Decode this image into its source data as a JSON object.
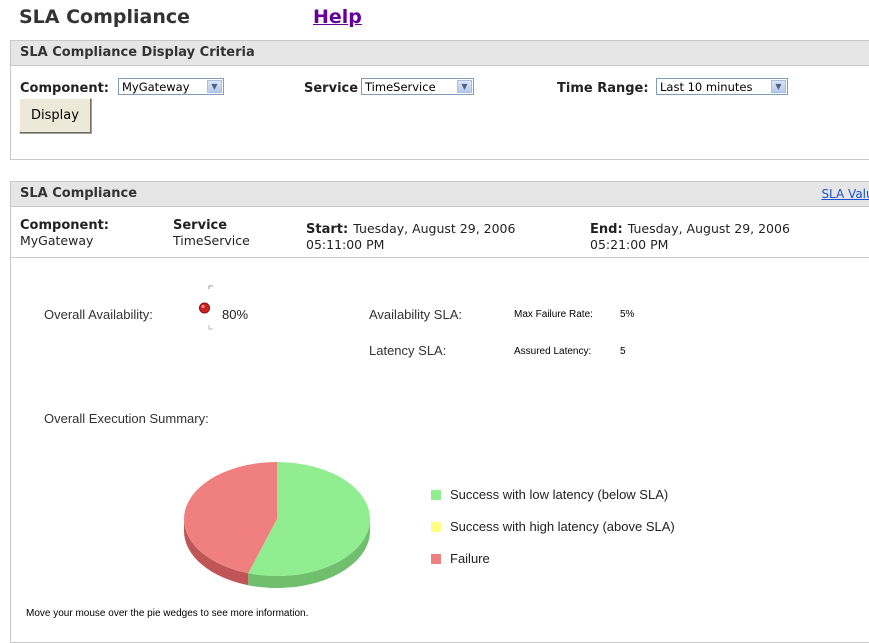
{
  "header": {
    "title": "SLA Compliance",
    "help_label": "Help"
  },
  "criteria": {
    "panel_title": "SLA Compliance Display Criteria",
    "component_label": "Component:",
    "component_value": "MyGateway",
    "service_label": "Service",
    "service_value": "TimeService",
    "time_range_label": "Time Range:",
    "time_range_value": "Last 10 minutes",
    "display_button": "Display"
  },
  "compliance": {
    "panel_title": "SLA Compliance",
    "sla_values_link": "SLA Value",
    "component_label": "Component:",
    "component_value": "MyGateway",
    "service_label": "Service",
    "service_value": "TimeService",
    "start_label": "Start:",
    "start_date": "Tuesday, August 29, 2006",
    "start_time": "05:11:00 PM",
    "end_label": "End:",
    "end_date": "Tuesday, August 29, 2006",
    "end_time": "05:21:00 PM",
    "overall_availability_label": "Overall Availability:",
    "overall_availability_value": "80%",
    "availability_sla_label": "Availability SLA:",
    "max_failure_rate_label": "Max Failure Rate:",
    "max_failure_rate_value": "5%",
    "latency_sla_label": "Latency SLA:",
    "assured_latency_label": "Assured Latency:",
    "assured_latency_value": "5",
    "execution_summary_label": "Overall Execution Summary:",
    "legend": [
      {
        "label": "Success with low latency (below SLA)",
        "color": "#90ee90"
      },
      {
        "label": "Success with high latency (above SLA)",
        "color": "#ffff80"
      },
      {
        "label": "Failure",
        "color": "#f08080"
      }
    ],
    "footer_note": "Move your mouse over the pie wedges to see more information."
  },
  "chart_data": {
    "type": "pie",
    "title": "",
    "slices": [
      {
        "label": "Success with low latency (below SLA)",
        "value": 55,
        "color": "#90ee90",
        "side_color": "#6fbf6f"
      },
      {
        "label": "Success with high latency (above SLA)",
        "value": 0,
        "color": "#ffff80",
        "side_color": "#cccc60"
      },
      {
        "label": "Failure",
        "value": 45,
        "color": "#f08080",
        "side_color": "#c05555"
      }
    ]
  },
  "colors": {
    "panel_header_bg": "#e6e6e6",
    "help_link": "#660099",
    "status_indicator": "#cc2222"
  }
}
